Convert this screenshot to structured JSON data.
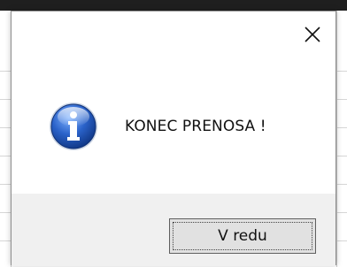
{
  "dialog": {
    "message": "KONEC PRENOSA !",
    "close_icon": "close-icon",
    "info_icon": "info-icon",
    "ok_label": "V redu"
  },
  "colors": {
    "dialog_bg": "#ffffff",
    "footer_bg": "#f0f0f0",
    "button_bg": "#e1e1e1",
    "info_icon_blue": "#1f55b8"
  }
}
